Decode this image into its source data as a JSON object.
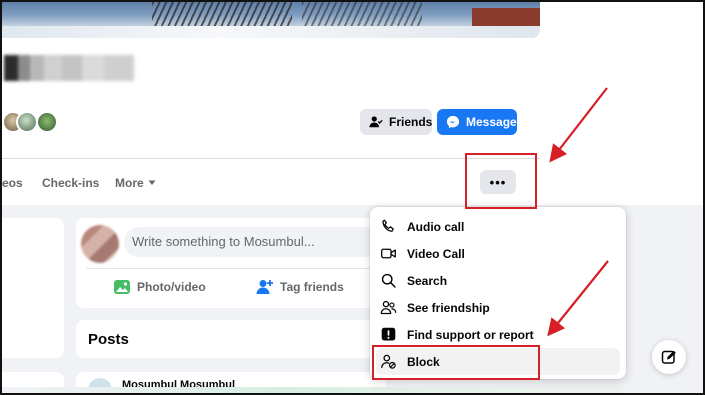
{
  "header": {
    "friends_label": "Friends",
    "message_label": "Message"
  },
  "tabs": {
    "videos_partial": "eos",
    "checkins": "Check-ins",
    "more": "More",
    "options_glyph": "•••"
  },
  "composer": {
    "placeholder": "Write something to Mosumbul...",
    "photo_video": "Photo/video",
    "tag_friends": "Tag friends"
  },
  "posts": {
    "title": "Posts",
    "first_author_partial": "Mosumbul Mosumbul"
  },
  "menu": {
    "items": [
      {
        "label": "Audio call",
        "icon": "phone-icon"
      },
      {
        "label": "Video Call",
        "icon": "video-camera-icon"
      },
      {
        "label": "Search",
        "icon": "search-icon"
      },
      {
        "label": "See friendship",
        "icon": "friendship-icon"
      },
      {
        "label": "Find support or report",
        "icon": "report-icon"
      },
      {
        "label": "Block",
        "icon": "block-user-icon"
      }
    ]
  },
  "colors": {
    "brand_blue": "#1877f2",
    "annotation_red": "#d61f26",
    "page_bg": "#f0f2f5",
    "button_grey": "#e4e6eb"
  }
}
